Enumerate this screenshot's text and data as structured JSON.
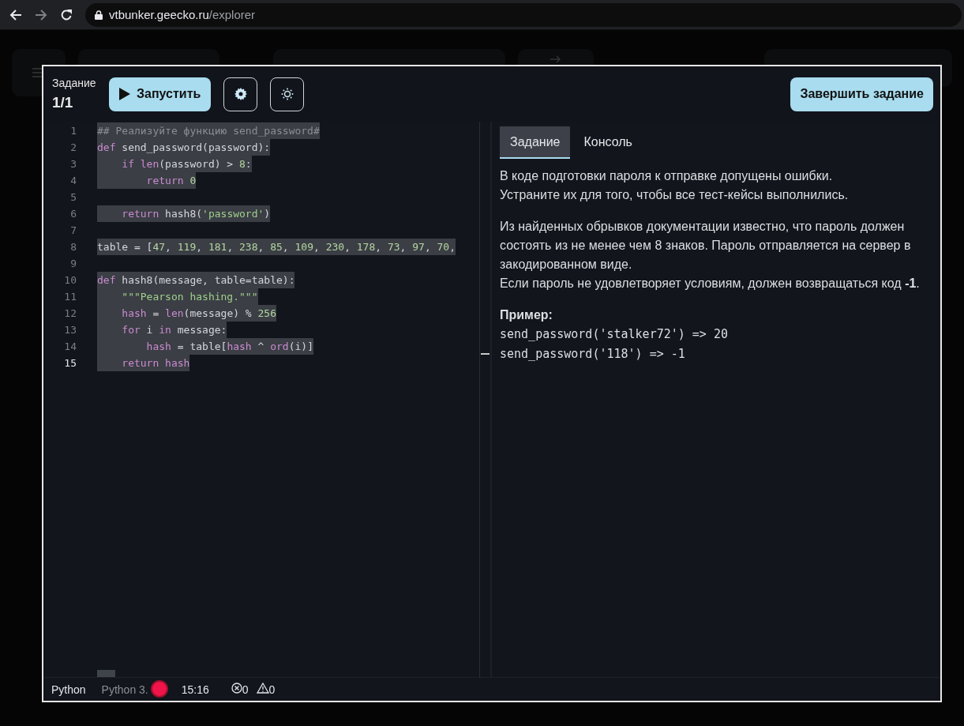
{
  "browser": {
    "url": {
      "host": "vtbunker.geecko.ru",
      "path": "/explorer"
    }
  },
  "toolbar": {
    "task_label": "Задание",
    "task_count": "1/1",
    "run_button": "Запустить",
    "finish_button": "Завершить задание"
  },
  "editor": {
    "selection": true,
    "lines": [
      {
        "number": "1",
        "current": false,
        "tokens": [
          {
            "kind": "comment",
            "text": "## Реализуйте функцию send_password#"
          }
        ]
      },
      {
        "number": "2",
        "current": false,
        "tokens": [
          {
            "kind": "kw",
            "text": "def"
          },
          {
            "kind": "plain",
            "text": " send_password(password):"
          }
        ]
      },
      {
        "number": "3",
        "current": false,
        "tokens": [
          {
            "kind": "kw",
            "text": "    if "
          },
          {
            "kind": "kw",
            "text": "len"
          },
          {
            "kind": "plain",
            "text": "(password) > "
          },
          {
            "kind": "num",
            "text": "8"
          },
          {
            "kind": "plain",
            "text": ":"
          }
        ]
      },
      {
        "number": "4",
        "current": false,
        "tokens": [
          {
            "kind": "kw",
            "text": "        return "
          },
          {
            "kind": "num",
            "text": "0"
          }
        ]
      },
      {
        "number": "5",
        "current": false
      },
      {
        "number": "6",
        "current": false,
        "tokens": [
          {
            "kind": "kw",
            "text": "    return"
          },
          {
            "kind": "plain",
            "text": " hash8("
          },
          {
            "kind": "str",
            "text": "'password'"
          },
          {
            "kind": "plain",
            "text": ")"
          }
        ]
      },
      {
        "number": "7",
        "current": false
      },
      {
        "number": "8",
        "current": false,
        "tokens": [
          {
            "kind": "plain",
            "text": "table = ["
          },
          {
            "kind": "num",
            "text": "47"
          },
          {
            "kind": "plain",
            "text": ", "
          },
          {
            "kind": "num",
            "text": "119"
          },
          {
            "kind": "plain",
            "text": ", "
          },
          {
            "kind": "num",
            "text": "181"
          },
          {
            "kind": "plain",
            "text": ", "
          },
          {
            "kind": "num",
            "text": "238"
          },
          {
            "kind": "plain",
            "text": ", "
          },
          {
            "kind": "num",
            "text": "85"
          },
          {
            "kind": "plain",
            "text": ", "
          },
          {
            "kind": "num",
            "text": "109"
          },
          {
            "kind": "plain",
            "text": ", "
          },
          {
            "kind": "num",
            "text": "230"
          },
          {
            "kind": "plain",
            "text": ", "
          },
          {
            "kind": "num",
            "text": "178"
          },
          {
            "kind": "plain",
            "text": ", "
          },
          {
            "kind": "num",
            "text": "73"
          },
          {
            "kind": "plain",
            "text": ", "
          },
          {
            "kind": "num",
            "text": "97"
          },
          {
            "kind": "plain",
            "text": ", "
          },
          {
            "kind": "num",
            "text": "70"
          },
          {
            "kind": "plain",
            "text": ","
          }
        ]
      },
      {
        "number": "9",
        "current": false
      },
      {
        "number": "10",
        "current": false,
        "tokens": [
          {
            "kind": "kw",
            "text": "def"
          },
          {
            "kind": "plain",
            "text": " hash8(message, table=table):"
          }
        ]
      },
      {
        "number": "11",
        "current": false,
        "tokens": [
          {
            "kind": "str",
            "text": "    \"\"\"Pearson hashing.\"\"\""
          }
        ]
      },
      {
        "number": "12",
        "current": false,
        "tokens": [
          {
            "kind": "kw",
            "text": "    hash"
          },
          {
            "kind": "plain",
            "text": " = "
          },
          {
            "kind": "kw",
            "text": "len"
          },
          {
            "kind": "plain",
            "text": "(message) % "
          },
          {
            "kind": "num",
            "text": "256"
          }
        ]
      },
      {
        "number": "13",
        "current": false,
        "tokens": [
          {
            "kind": "kw",
            "text": "    for"
          },
          {
            "kind": "plain",
            "text": " i "
          },
          {
            "kind": "kw",
            "text": "in"
          },
          {
            "kind": "plain",
            "text": " message:"
          }
        ]
      },
      {
        "number": "14",
        "current": false,
        "tokens": [
          {
            "kind": "kw",
            "text": "        hash"
          },
          {
            "kind": "plain",
            "text": " = table["
          },
          {
            "kind": "kw",
            "text": "hash"
          },
          {
            "kind": "plain",
            "text": " ^ "
          },
          {
            "kind": "kw",
            "text": "ord"
          },
          {
            "kind": "plain",
            "text": "(i)]"
          }
        ]
      },
      {
        "number": "15",
        "current": true,
        "tokens": [
          {
            "kind": "kw",
            "text": "    return hash"
          }
        ]
      }
    ]
  },
  "panel": {
    "tabs": [
      {
        "label": "Задание",
        "selected": true
      },
      {
        "label": "Консоль",
        "selected": false
      }
    ],
    "paragraphs": [
      [
        "В коде подготовки пароля к отправке допущены ошибки.",
        "Устраните их для того, чтобы все тест-кейсы выполнились."
      ],
      [
        "Из найденных обрывков документации известно, что пароль должен состоять из не менее чем 8 знаков. Пароль отправляется на сервер в закодированном виде.",
        "Если пароль не удовлетворяет условиям, должен возвращаться код **-1**."
      ]
    ],
    "example_title": "Пример:",
    "examples": [
      "send_password('stalker72') => 20",
      "send_password('118') => -1"
    ]
  },
  "status_bar": {
    "language": "Python",
    "interpreter": "Python 3.",
    "recording": true,
    "time": "15:16",
    "errors": "0",
    "warnings": "0"
  }
}
